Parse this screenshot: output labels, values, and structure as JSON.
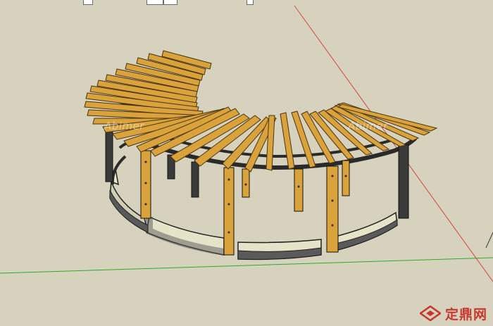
{
  "scene": {
    "watermark_left": "Abimer",
    "watermark_right": "Abimer",
    "axis_colors": {
      "red": "#d3463f",
      "green": "#2eaa2e"
    },
    "wood_color": "#d9a23b",
    "post_color": "#3a3a3a",
    "bench_color": "#e6e4c8"
  },
  "brand": {
    "logo_text": "定鼎网",
    "logo_icon": "diamond-logo-icon"
  }
}
